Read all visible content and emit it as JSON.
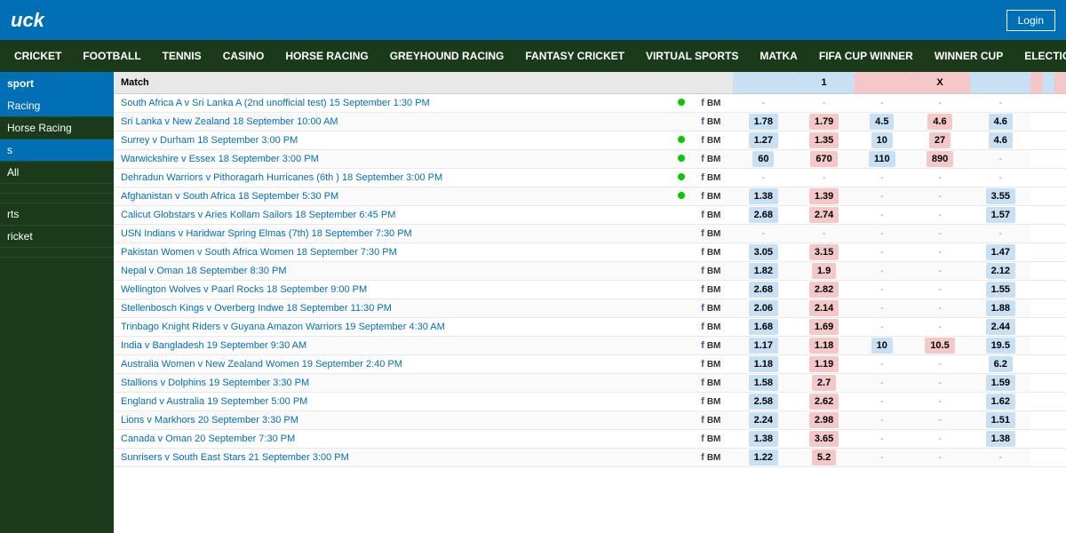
{
  "header": {
    "logo": "uck",
    "login_label": "Login"
  },
  "nav": {
    "items": [
      {
        "label": "CRICKET",
        "active": false
      },
      {
        "label": "FOOTBALL",
        "active": false
      },
      {
        "label": "TENNIS",
        "active": false
      },
      {
        "label": "CASINO",
        "active": false
      },
      {
        "label": "HORSE RACING",
        "active": false
      },
      {
        "label": "GREYHOUND RACING",
        "active": false
      },
      {
        "label": "FANTASY CRICKET",
        "active": false
      },
      {
        "label": "VIRTUAL SPORTS",
        "active": false
      },
      {
        "label": "MATKA",
        "active": false
      },
      {
        "label": "FIFA CUP WINNER",
        "active": false
      },
      {
        "label": "WINNER CUP",
        "active": false
      },
      {
        "label": "ELECTION",
        "active": false
      }
    ]
  },
  "sidebar": {
    "header": "sport",
    "items": [
      {
        "label": "Racing",
        "active": true
      },
      {
        "label": "Horse Racing",
        "active": false
      },
      {
        "label": "s",
        "active": true
      },
      {
        "label": "All",
        "active": false
      },
      {
        "label": "",
        "active": false
      },
      {
        "label": "",
        "active": false
      },
      {
        "label": "rts",
        "active": false
      },
      {
        "label": "ricket",
        "active": false
      },
      {
        "label": "",
        "active": false
      }
    ]
  },
  "table": {
    "col1_header": "1",
    "colx_header": "X",
    "match_col": "Match",
    "rows": [
      {
        "match": "South Africa A v Sri Lanka A (2nd unofficial test) 15 September 1:30 PM",
        "live": true,
        "b1": "-",
        "b2": "-",
        "b3": "-",
        "b4": "-",
        "b5": "-",
        "b6": "-"
      },
      {
        "match": "Sri Lanka v New Zealand 18 September 10:00 AM",
        "live": false,
        "b1": "1.78",
        "b2": "1.79",
        "b3": "4.5",
        "b4": "4.6",
        "b5": "",
        "b6": "4.6"
      },
      {
        "match": "Surrey v Durham 18 September 3:00 PM",
        "live": true,
        "b1": "1.27",
        "b2": "1.35",
        "b3": "10",
        "b4": "27",
        "b5": "",
        "b6": "4.6"
      },
      {
        "match": "Warwickshire v Essex 18 September 3:00 PM",
        "live": true,
        "b1": "60",
        "b2": "670",
        "b3": "110",
        "b4": "890",
        "b5": "",
        "b6": "-"
      },
      {
        "match": "Dehradun Warriors v Pithoragarh Hurricanes (6th ) 18 September 3:00 PM",
        "live": true,
        "b1": "-",
        "b2": "-",
        "b3": "-",
        "b4": "-",
        "b5": "",
        "b6": "-"
      },
      {
        "match": "Afghanistan v South Africa 18 September 5:30 PM",
        "live": true,
        "b1": "1.38",
        "b2": "1.39",
        "b3": "-",
        "b4": "-",
        "b5": "",
        "b6": "3.55"
      },
      {
        "match": "Calicut Globstars v Aries Kollam Sailors 18 September 6:45 PM",
        "live": false,
        "b1": "2.68",
        "b2": "2.74",
        "b3": "-",
        "b4": "-",
        "b5": "",
        "b6": "1.57"
      },
      {
        "match": "USN Indians v Haridwar Spring Elmas (7th) 18 September 7:30 PM",
        "live": false,
        "b1": "-",
        "b2": "-",
        "b3": "-",
        "b4": "-",
        "b5": "",
        "b6": "-"
      },
      {
        "match": "Pakistan Women v South Africa Women 18 September 7:30 PM",
        "live": false,
        "b1": "3.05",
        "b2": "3.15",
        "b3": "-",
        "b4": "-",
        "b5": "",
        "b6": "1.47"
      },
      {
        "match": "Nepal v Oman 18 September 8:30 PM",
        "live": false,
        "b1": "1.82",
        "b2": "1.9",
        "b3": "-",
        "b4": "-",
        "b5": "",
        "b6": "2.12"
      },
      {
        "match": "Wellington Wolves v Paarl Rocks 18 September 9:00 PM",
        "live": false,
        "b1": "2.68",
        "b2": "2.82",
        "b3": "-",
        "b4": "-",
        "b5": "",
        "b6": "1.55"
      },
      {
        "match": "Stellenbosch Kings v Overberg Indwe 18 September 11:30 PM",
        "live": false,
        "b1": "2.06",
        "b2": "2.14",
        "b3": "-",
        "b4": "-",
        "b5": "",
        "b6": "1.88"
      },
      {
        "match": "Trinbago Knight Riders v Guyana Amazon Warriors 19 September 4:30 AM",
        "live": false,
        "b1": "1.68",
        "b2": "1.69",
        "b3": "-",
        "b4": "-",
        "b5": "",
        "b6": "2.44"
      },
      {
        "match": "India v Bangladesh 19 September 9:30 AM",
        "live": false,
        "b1": "1.17",
        "b2": "1.18",
        "b3": "10",
        "b4": "10.5",
        "b5": "",
        "b6": "19.5"
      },
      {
        "match": "Australia Women v New Zealand Women 19 September 2:40 PM",
        "live": false,
        "b1": "1.18",
        "b2": "1.19",
        "b3": "-",
        "b4": "-",
        "b5": "",
        "b6": "6.2"
      },
      {
        "match": "Stallions v Dolphins 19 September 3:30 PM",
        "live": false,
        "b1": "1.58",
        "b2": "2.7",
        "b3": "-",
        "b4": "-",
        "b5": "",
        "b6": "1.59"
      },
      {
        "match": "England v Australia 19 September 5:00 PM",
        "live": false,
        "b1": "2.58",
        "b2": "2.62",
        "b3": "-",
        "b4": "-",
        "b5": "",
        "b6": "1.62"
      },
      {
        "match": "Lions v Markhors 20 September 3:30 PM",
        "live": false,
        "b1": "2.24",
        "b2": "2.98",
        "b3": "-",
        "b4": "-",
        "b5": "",
        "b6": "1.51"
      },
      {
        "match": "Canada v Oman 20 September 7:30 PM",
        "live": false,
        "b1": "1.38",
        "b2": "3.65",
        "b3": "-",
        "b4": "-",
        "b5": "",
        "b6": "1.38"
      },
      {
        "match": "Sunrisers v South East Stars 21 September 3:00 PM",
        "live": false,
        "b1": "1.22",
        "b2": "5.2",
        "b3": "-",
        "b4": "-",
        "b5": "",
        "b6": "-"
      }
    ]
  }
}
